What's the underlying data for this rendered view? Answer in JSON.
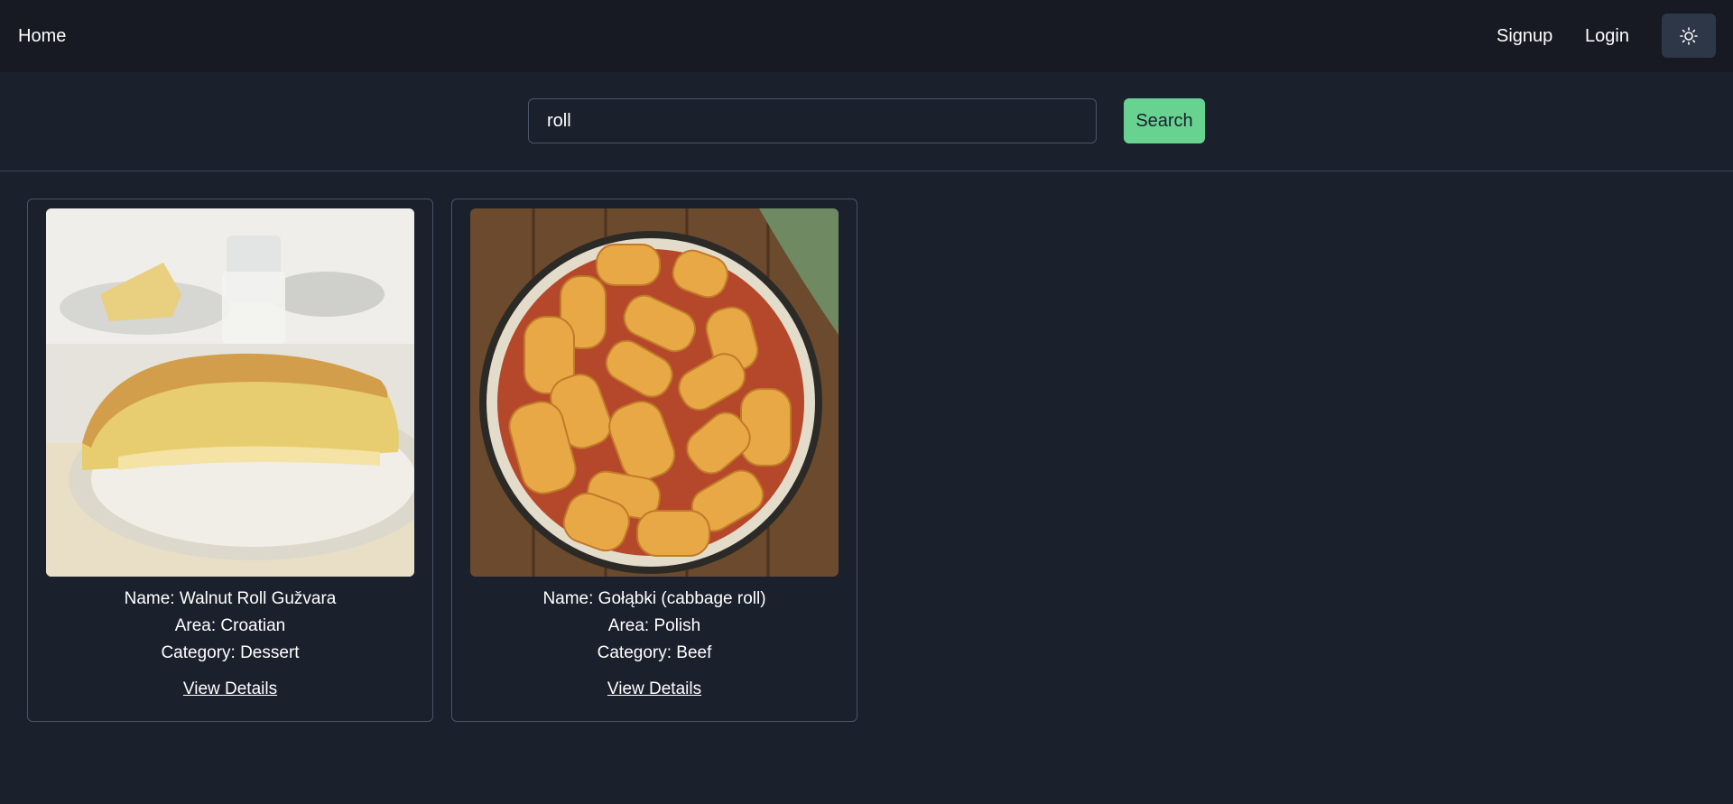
{
  "nav": {
    "home_label": "Home",
    "signup_label": "Signup",
    "login_label": "Login",
    "theme_icon": "sun-icon"
  },
  "search": {
    "value": "roll",
    "button_label": "Search"
  },
  "colors": {
    "background": "#1a202c",
    "navbar": "#171923",
    "accent": "#68d391"
  },
  "meals": [
    {
      "name": "Name: Walnut Roll Gužvara",
      "area": "Area: Croatian",
      "category": "Category: Dessert",
      "link": "View Details"
    },
    {
      "name": "Name: Gołąbki (cabbage roll)",
      "area": "Area: Polish",
      "category": "Category: Beef",
      "link": "View Details"
    }
  ]
}
